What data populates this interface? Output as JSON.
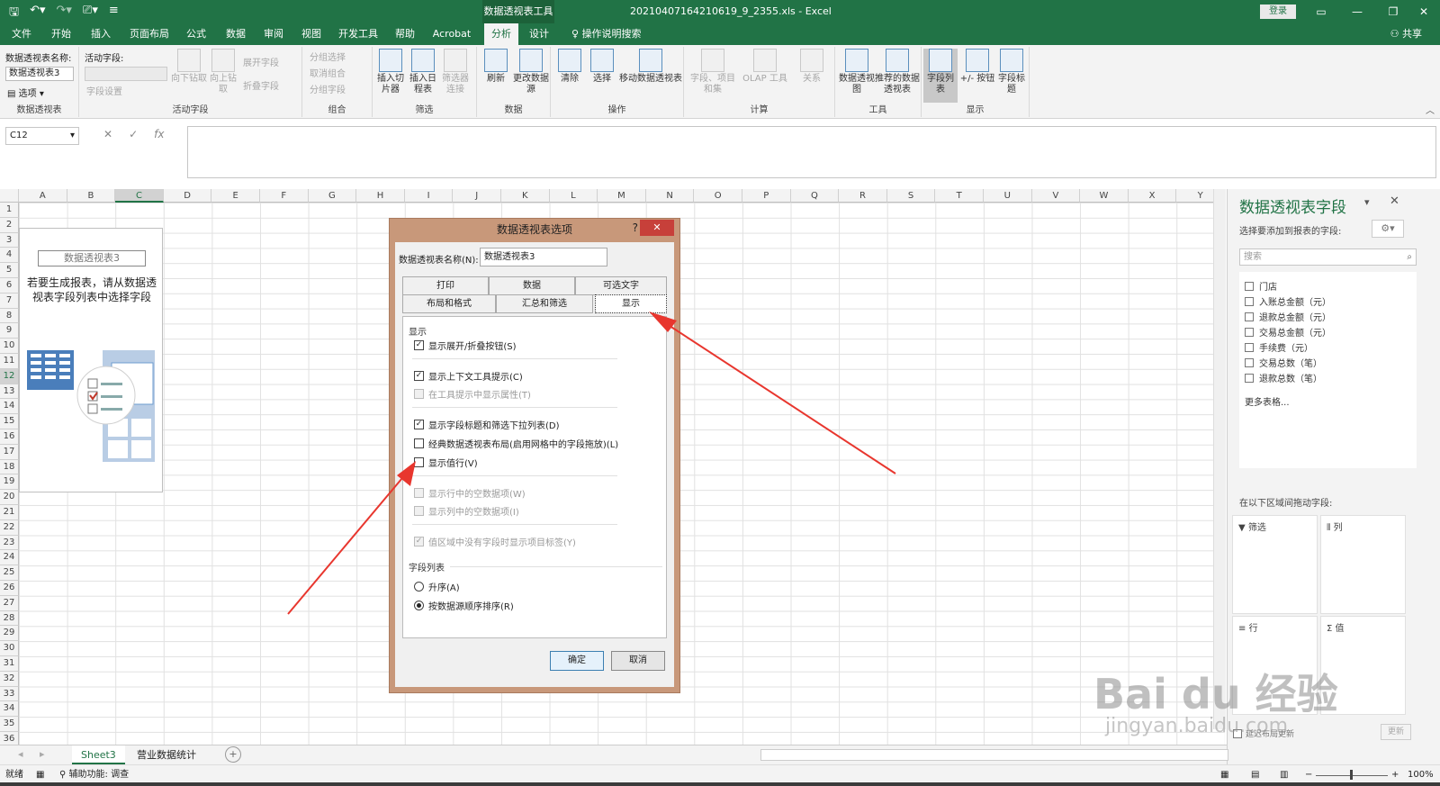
{
  "title_bar": {
    "qat_icons": [
      "save-icon",
      "undo-icon",
      "redo-icon",
      "touch-mode-icon",
      "customize-icon"
    ],
    "context_tab": "数据透视表工具",
    "doc_title": "20210407164210619_9_2355.xls  -  Excel",
    "login": "登录"
  },
  "menu": {
    "tabs": [
      "文件",
      "开始",
      "插入",
      "页面布局",
      "公式",
      "数据",
      "审阅",
      "视图",
      "开发工具",
      "帮助",
      "Acrobat",
      "分析",
      "设计"
    ],
    "tell_me": "操作说明搜索",
    "share": "共享"
  },
  "ribbon": {
    "pivot_name_label": "数据透视表名称:",
    "pivot_name_value": "数据透视表3",
    "options": "选项",
    "group_pivot": "数据透视表",
    "active_field_label": "活动字段:",
    "field_settings": "字段设置",
    "drill_down": "向下钻取",
    "drill_up": "向上钻取",
    "expand_field": "展开字段",
    "collapse_field": "折叠字段",
    "group_active": "活动字段",
    "group_selection": "分组选择",
    "ungroup": "取消组合",
    "group_field": "分组字段",
    "group_group": "组合",
    "insert_slicer": "插入切片器",
    "insert_timeline": "插入日程表",
    "filter_connections": "筛选器连接",
    "group_filter": "筛选",
    "refresh": "刷新",
    "change_source": "更改数据源",
    "group_data": "数据",
    "clear": "清除",
    "select": "选择",
    "move_pivot": "移动数据透视表",
    "group_actions": "操作",
    "fields_items": "字段、项目和集",
    "olap_tools": "OLAP 工具",
    "relationships": "关系",
    "group_calc": "计算",
    "pivot_chart": "数据透视图",
    "recommended": "推荐的数据透视表",
    "group_tools": "工具",
    "field_list": "字段列表",
    "plus_minus": "+/- 按钮",
    "field_headers": "字段标题",
    "group_show": "显示"
  },
  "formula_bar": {
    "name_box": "C12",
    "fx": "fx"
  },
  "grid": {
    "columns": [
      "A",
      "B",
      "C",
      "D",
      "E",
      "F",
      "G",
      "H",
      "I",
      "J",
      "K",
      "L",
      "M",
      "N",
      "O",
      "P",
      "Q",
      "R",
      "S",
      "T",
      "U",
      "V",
      "W",
      "X",
      "Y"
    ],
    "rows": [
      "1",
      "2",
      "3",
      "4",
      "5",
      "6",
      "7",
      "8",
      "9",
      "10",
      "11",
      "12",
      "13",
      "14",
      "15",
      "16",
      "17",
      "18",
      "19",
      "20",
      "21",
      "22",
      "23",
      "24",
      "25",
      "26",
      "27",
      "28",
      "29",
      "30",
      "31",
      "32",
      "33",
      "34",
      "35",
      "36"
    ]
  },
  "placeholder": {
    "title": "数据透视表3",
    "text": "若要生成报表，请从数据透视表字段列表中选择字段"
  },
  "sheets": {
    "tabs": [
      "Sheet3",
      "营业数据统计"
    ]
  },
  "status": {
    "ready": "就绪",
    "accessibility": "辅助功能: 调查",
    "zoom": "100%"
  },
  "pane": {
    "title": "数据透视表字段",
    "subtitle": "选择要添加到报表的字段:",
    "search_placeholder": "搜索",
    "fields": [
      "门店",
      "入账总金额（元）",
      "退款总金额（元）",
      "交易总金额（元）",
      "手续费（元）",
      "交易总数（笔）",
      "退款总数（笔）"
    ],
    "more_tables": "更多表格...",
    "drag_label": "在以下区域间拖动字段:",
    "areas": [
      "筛选",
      "列",
      "行",
      "值"
    ],
    "defer_update": "延迟布局更新",
    "update": "更新"
  },
  "dialog": {
    "title": "数据透视表选项",
    "help": "?",
    "close": "✕",
    "name_label": "数据透视表名称(N):",
    "name_value": "数据透视表3",
    "tabs_row1": [
      "打印",
      "数据",
      "可选文字"
    ],
    "tabs_row2": [
      "布局和格式",
      "汇总和筛选",
      "显示"
    ],
    "section_display": "显示",
    "options": [
      {
        "label": "显示展开/折叠按钮(S)",
        "checked": true,
        "disabled": false
      },
      {
        "label": "显示上下文工具提示(C)",
        "checked": true,
        "disabled": false
      },
      {
        "label": "在工具提示中显示属性(T)",
        "checked": false,
        "disabled": true
      },
      {
        "label": "显示字段标题和筛选下拉列表(D)",
        "checked": true,
        "disabled": false
      },
      {
        "label": "经典数据透视表布局(启用网格中的字段拖放)(L)",
        "checked": false,
        "disabled": false
      },
      {
        "label": "显示值行(V)",
        "checked": false,
        "disabled": false
      },
      {
        "label": "显示行中的空数据项(W)",
        "checked": false,
        "disabled": true
      },
      {
        "label": "显示列中的空数据项(I)",
        "checked": false,
        "disabled": true
      },
      {
        "label": "值区域中没有字段时显示项目标签(Y)",
        "checked": true,
        "disabled": true
      }
    ],
    "section_fieldlist": "字段列表",
    "radio_asc": "升序(A)",
    "radio_source": "按数据源顺序排序(R)",
    "ok": "确定",
    "cancel": "取消"
  },
  "watermark": {
    "brand": "Bai du 经验",
    "url": "jingyan.baidu.com"
  },
  "colors": {
    "excel_green": "#217346",
    "dialog_frame": "#c8987a",
    "arrow_red": "#e8362e"
  }
}
